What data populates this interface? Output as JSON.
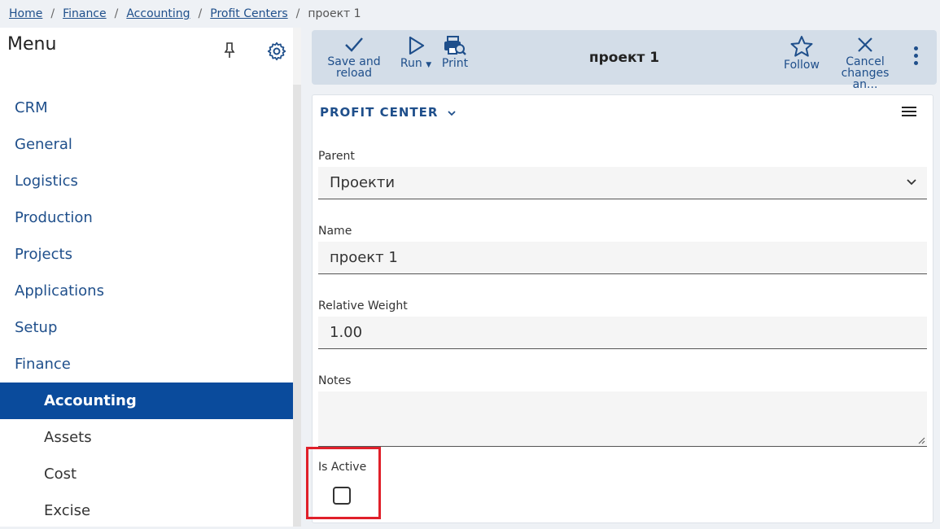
{
  "breadcrumb": {
    "items": [
      "Home",
      "Finance",
      "Accounting",
      "Profit Centers"
    ],
    "current": "проект 1"
  },
  "sidebar": {
    "title": "Menu",
    "items": [
      {
        "label": "CRM"
      },
      {
        "label": "General"
      },
      {
        "label": "Logistics"
      },
      {
        "label": "Production"
      },
      {
        "label": "Projects"
      },
      {
        "label": "Applications"
      },
      {
        "label": "Setup"
      },
      {
        "label": "Finance"
      },
      {
        "label": "Accounting"
      },
      {
        "label": "Assets"
      },
      {
        "label": "Cost"
      },
      {
        "label": "Excise"
      }
    ]
  },
  "toolbar": {
    "save_label_1": "Save and",
    "save_label_2": "reload",
    "run_label": "Run",
    "print_label": "Print",
    "title": "проект 1",
    "follow_label": "Follow",
    "cancel_label_1": "Cancel",
    "cancel_label_2": "changes an..."
  },
  "form": {
    "section_title": "PROFIT CENTER",
    "parent": {
      "label": "Parent",
      "value": "Проекти"
    },
    "name": {
      "label": "Name",
      "value": "проект 1"
    },
    "relative_weight": {
      "label": "Relative Weight",
      "value": "1.00"
    },
    "notes": {
      "label": "Notes",
      "value": ""
    },
    "is_active": {
      "label": "Is Active",
      "checked": false
    }
  },
  "colors": {
    "accent": "#1f4f8b",
    "active_menu_bg": "#0a4b9c",
    "highlight_border": "#e0202a"
  }
}
